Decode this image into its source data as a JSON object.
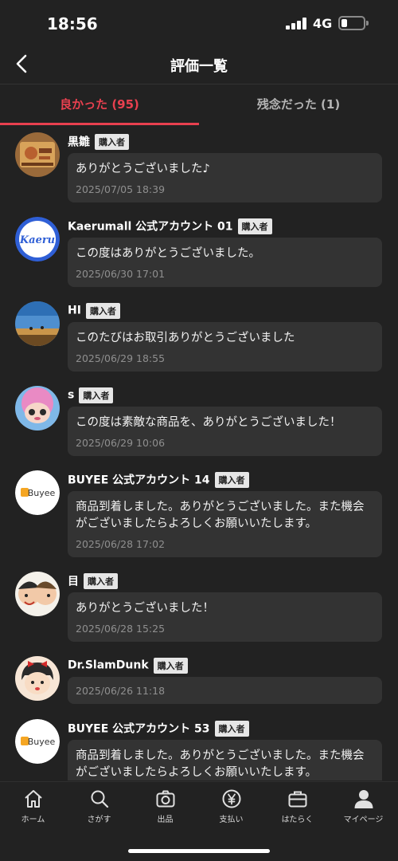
{
  "status_bar": {
    "time": "18:56",
    "network": "4G",
    "battery_level": 0.2
  },
  "header": {
    "title": "評価一覧",
    "back_icon": "chevron-left-icon"
  },
  "tabs": [
    {
      "label": "良かった (95)",
      "active": true
    },
    {
      "label": "残念だった (1)",
      "active": false
    }
  ],
  "colors": {
    "accent": "#e8404f",
    "background": "#222222",
    "bubble": "#333333"
  },
  "reviews": [
    {
      "name": "黒雛",
      "badge": "購入者",
      "comment": "ありがとうございました♪",
      "date": "2025/07/05 18:39",
      "avatar": "photo-avatar"
    },
    {
      "name": "Kaerumall 公式アカウント 01",
      "badge": "購入者",
      "comment": "この度はありがとうございました。",
      "date": "2025/06/30 17:01",
      "avatar": "kaeru-logo-avatar",
      "avatar_text": "Kaeru"
    },
    {
      "name": "HI",
      "badge": "購入者",
      "comment": "このたびはお取引ありがとうございました",
      "date": "2025/06/29 18:55",
      "avatar": "landscape-avatar"
    },
    {
      "name": "s",
      "badge": "購入者",
      "comment": "この度は素敵な商品を、ありがとうございました！",
      "date": "2025/06/29 10:06",
      "avatar": "doll-avatar"
    },
    {
      "name": "BUYEE 公式アカウント 14",
      "badge": "購入者",
      "comment": "商品到着しました。ありがとうございました。また機会がございましたらよろしくお願いいたします。",
      "date": "2025/06/28 17:02",
      "avatar": "buyee-logo-avatar",
      "avatar_text": "Buyee"
    },
    {
      "name": "目",
      "badge": "購入者",
      "comment": "ありがとうございました！",
      "date": "2025/06/28 15:25",
      "avatar": "cartoon-avatar"
    },
    {
      "name": "Dr.SlamDunk",
      "badge": "購入者",
      "comment": "",
      "date": "2025/06/26 11:18",
      "avatar": "character-avatar"
    },
    {
      "name": "BUYEE 公式アカウント 53",
      "badge": "購入者",
      "comment": "商品到着しました。ありがとうございました。また機会がございましたらよろしくお願いいたします。",
      "date": "",
      "avatar": "buyee-logo-avatar",
      "avatar_text": "Buyee"
    }
  ],
  "tab_bar": [
    {
      "label": "ホーム",
      "icon": "home-icon"
    },
    {
      "label": "さがす",
      "icon": "search-icon"
    },
    {
      "label": "出品",
      "icon": "camera-icon"
    },
    {
      "label": "支払い",
      "icon": "yen-icon"
    },
    {
      "label": "はたらく",
      "icon": "briefcase-icon"
    },
    {
      "label": "マイページ",
      "icon": "person-icon"
    }
  ]
}
